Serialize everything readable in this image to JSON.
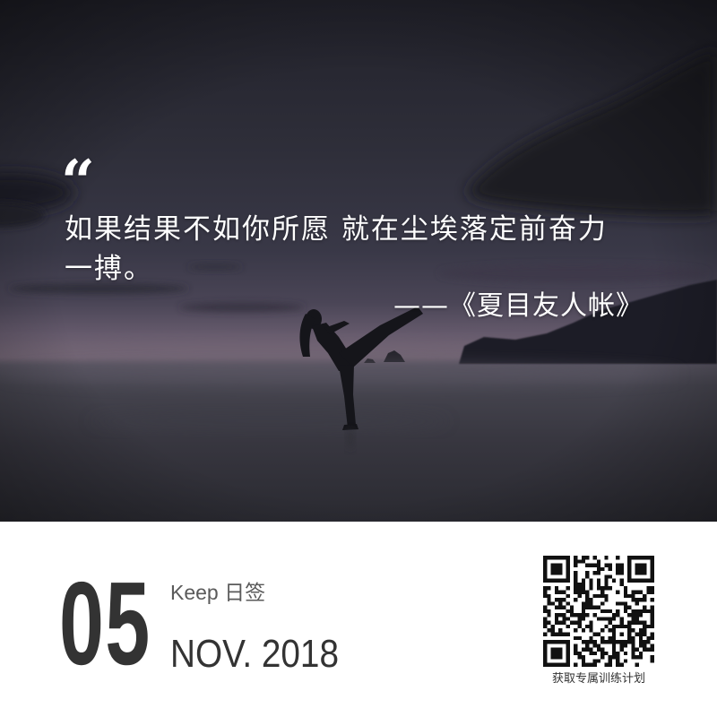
{
  "card": {
    "quote_mark": "“",
    "quote_lines": [
      "如果结果不如你所愿 就在尘埃落定前奋力",
      "一搏。"
    ],
    "attribution": "——《夏目友人帐》"
  },
  "footer": {
    "day": "05",
    "brand": "Keep 日签",
    "month_year": "NOV. 2018",
    "qr_caption": "获取专属训练计划"
  },
  "icons": {
    "qr": "qr-code-icon"
  },
  "colors": {
    "text_light": "#ffffff",
    "text_dark": "#333333",
    "text_muted": "#5a5a5a",
    "footer_background": "#ffffff"
  }
}
